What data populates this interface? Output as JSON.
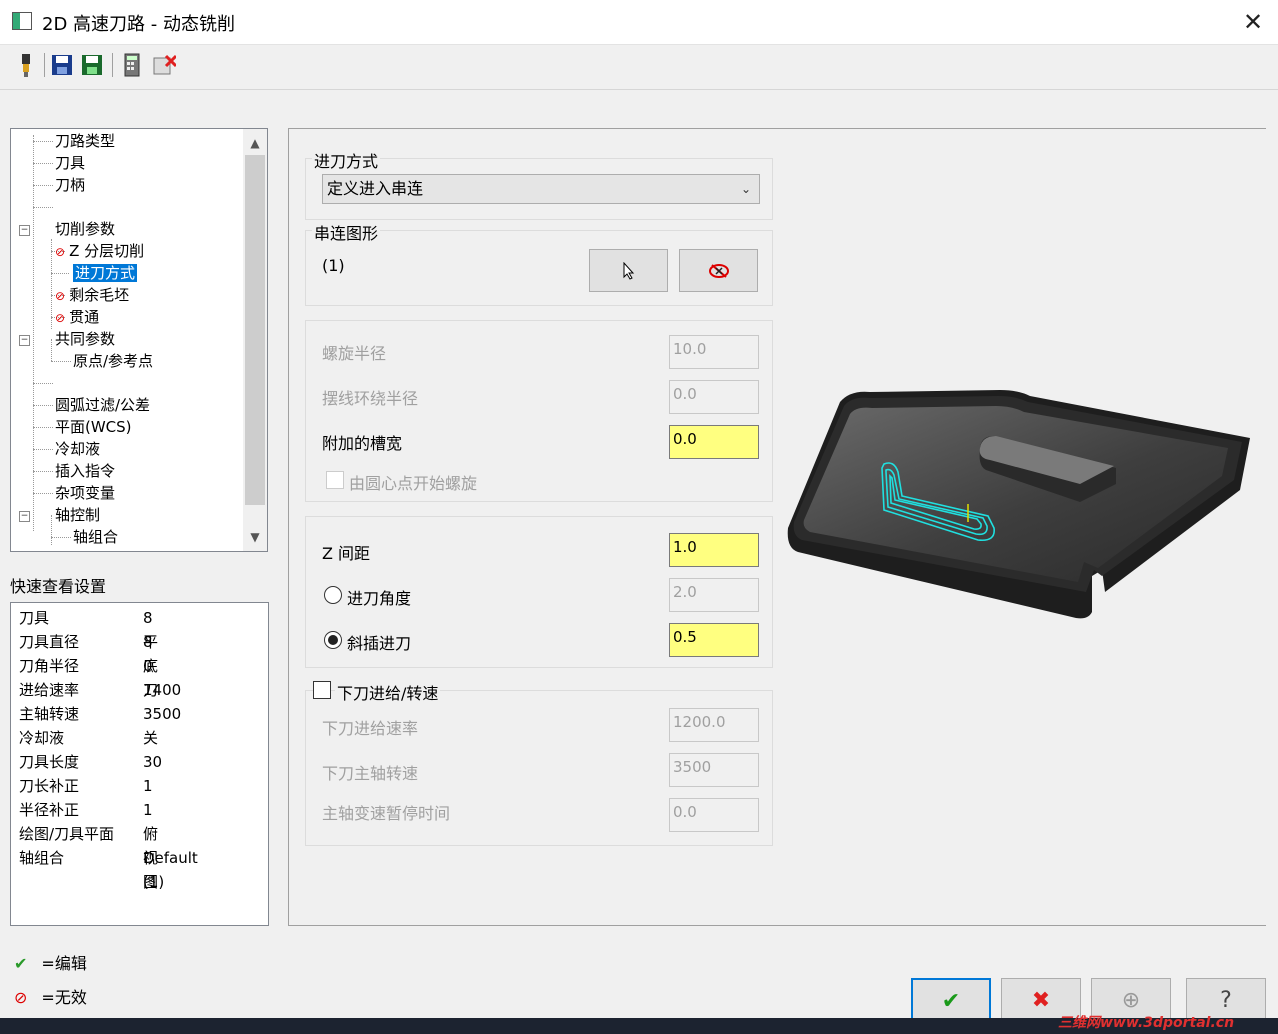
{
  "window": {
    "title": "2D 高速刀路 - 动态铣削",
    "close_glyph": "✕"
  },
  "toolbar": {
    "icons": [
      "tool-icon",
      "save-icon",
      "save-as-icon",
      "calculator-icon",
      "delete-icon"
    ]
  },
  "tree": {
    "items": [
      {
        "label": "刀路类型"
      },
      {
        "label": "刀具"
      },
      {
        "label": "刀柄"
      },
      {
        "label": "切削参数"
      },
      {
        "label": "Z 分层切削"
      },
      {
        "label": "进刀方式"
      },
      {
        "label": "剩余毛坯"
      },
      {
        "label": "贯通"
      },
      {
        "label": "共同参数"
      },
      {
        "label": "原点/参考点"
      },
      {
        "label": "圆弧过滤/公差"
      },
      {
        "label": "平面(WCS)"
      },
      {
        "label": "冷却液"
      },
      {
        "label": "插入指令"
      },
      {
        "label": "杂项变量"
      },
      {
        "label": "轴控制"
      },
      {
        "label": "轴组合"
      }
    ]
  },
  "quick_view": {
    "label": "快速查看设置",
    "rows": [
      {
        "k": "刀具",
        "v": "8 平底刀"
      },
      {
        "k": "刀具直径",
        "v": "8"
      },
      {
        "k": "刀角半径",
        "v": "0"
      },
      {
        "k": "进给速率",
        "v": "1400"
      },
      {
        "k": "主轴转速",
        "v": "3500"
      },
      {
        "k": "冷却液",
        "v": "关"
      },
      {
        "k": "刀具长度",
        "v": "30"
      },
      {
        "k": "刀长补正",
        "v": "1"
      },
      {
        "k": "半径补正",
        "v": "1"
      },
      {
        "k": "绘图/刀具平面",
        "v": "俯视图"
      },
      {
        "k": "轴组合",
        "v": "Default (1)"
      }
    ]
  },
  "legend": {
    "edit": "=编辑",
    "invalid": "=无效"
  },
  "entry": {
    "group_title": "进刀方式",
    "combo_value": "定义进入串连",
    "chain_group_title": "串连图形",
    "chain_count": "(1)",
    "helix_radius_label": "螺旋半径",
    "helix_radius": "10.0",
    "trochoid_radius_label": "摆线环绕半径",
    "trochoid_radius": "0.0",
    "extra_slot_label": "附加的槽宽",
    "extra_slot": "0.0",
    "center_helix_label": "由圆心点开始螺旋",
    "z_step_label": "Z 间距",
    "z_step": "1.0",
    "entry_angle_label": "进刀角度",
    "entry_angle": "2.0",
    "ramp_label": "斜插进刀",
    "ramp": "0.5",
    "plunge_group_label": "下刀进给/转速",
    "plunge_feed_label": "下刀进给速率",
    "plunge_feed": "1200.0",
    "plunge_speed_label": "下刀主轴转速",
    "plunge_speed": "3500",
    "dwell_label": "主轴变速暂停时间",
    "dwell": "0.0"
  },
  "buttons": {
    "ok": "✔",
    "cancel": "✖",
    "add": "⊕",
    "help": "?"
  },
  "watermark": "三维网www.3dportal.cn",
  "colors": {
    "selection": "#0078d7",
    "highlight_input": "#ffff80",
    "toolpath": "#20e0e0"
  }
}
